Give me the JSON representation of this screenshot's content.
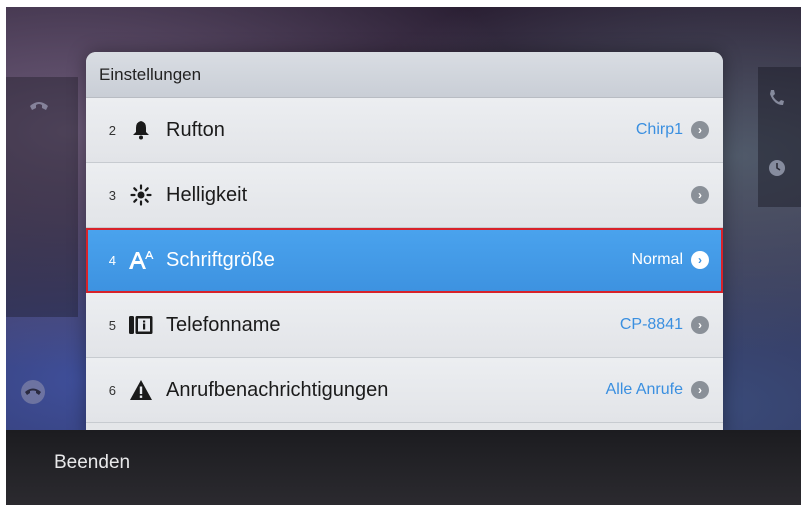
{
  "panel": {
    "title": "Einstellungen",
    "rows": [
      {
        "num": "2",
        "icon": "bell-icon",
        "label": "Rufton",
        "value": "Chirp1",
        "selected": false
      },
      {
        "num": "3",
        "icon": "brightness-icon",
        "label": "Helligkeit",
        "value": "",
        "selected": false
      },
      {
        "num": "4",
        "icon": "font-size-icon",
        "label": "Schriftgröße",
        "value": "Normal",
        "selected": true
      },
      {
        "num": "5",
        "icon": "phone-info-icon",
        "label": "Telefonname",
        "value": "CP-8841",
        "selected": false
      },
      {
        "num": "6",
        "icon": "warning-icon",
        "label": "Anrufbenachrichtigungen",
        "value": "Alle Anrufe",
        "selected": false
      }
    ]
  },
  "softkeys": {
    "exit_label": "Beenden"
  },
  "colors": {
    "selection": "#3d92e0",
    "value_text": "#3a8fe0",
    "highlight_outline": "#d8222a"
  }
}
